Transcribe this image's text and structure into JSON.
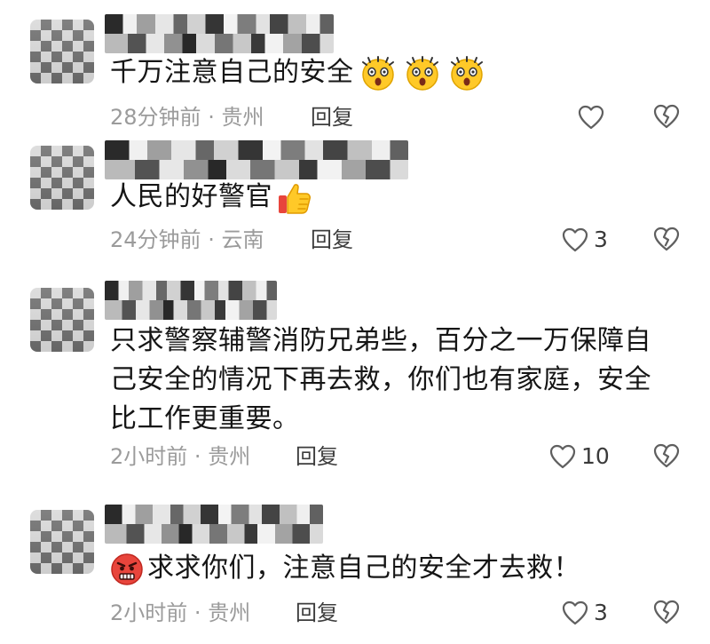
{
  "comments": [
    {
      "text": "千万注意自己的安全",
      "emojis": [
        "shocked-emoji",
        "shocked-emoji",
        "shocked-emoji"
      ],
      "time": "28分钟前",
      "location": "贵州",
      "reply_label": "回复",
      "likes": ""
    },
    {
      "text": "人民的好警官",
      "emojis": [
        "thumbs-up-emoji"
      ],
      "time": "24分钟前",
      "location": "云南",
      "reply_label": "回复",
      "likes": "3"
    },
    {
      "text_lines": [
        "只求警察辅警消防兄弟些，百分之一万保障自",
        "己安全的情况下再去救，你们也有家庭，安全",
        "比工作更重要。"
      ],
      "time": "2小时前",
      "location": "贵州",
      "reply_label": "回复",
      "likes": "10"
    },
    {
      "text": "求求你们，注意自己的安全才去救！",
      "emojis_before": [
        "angry-face-emoji"
      ],
      "time": "2小时前",
      "location": "贵州",
      "reply_label": "回复",
      "likes": "3"
    }
  ],
  "meta_separator": "·",
  "colors": {
    "meta_gray": "#9b9b9b",
    "text_dark": "#151515",
    "icon_gray": "#5f5f5f"
  },
  "icons": {
    "like": "heart-outline-icon",
    "dislike": "broken-heart-icon"
  }
}
